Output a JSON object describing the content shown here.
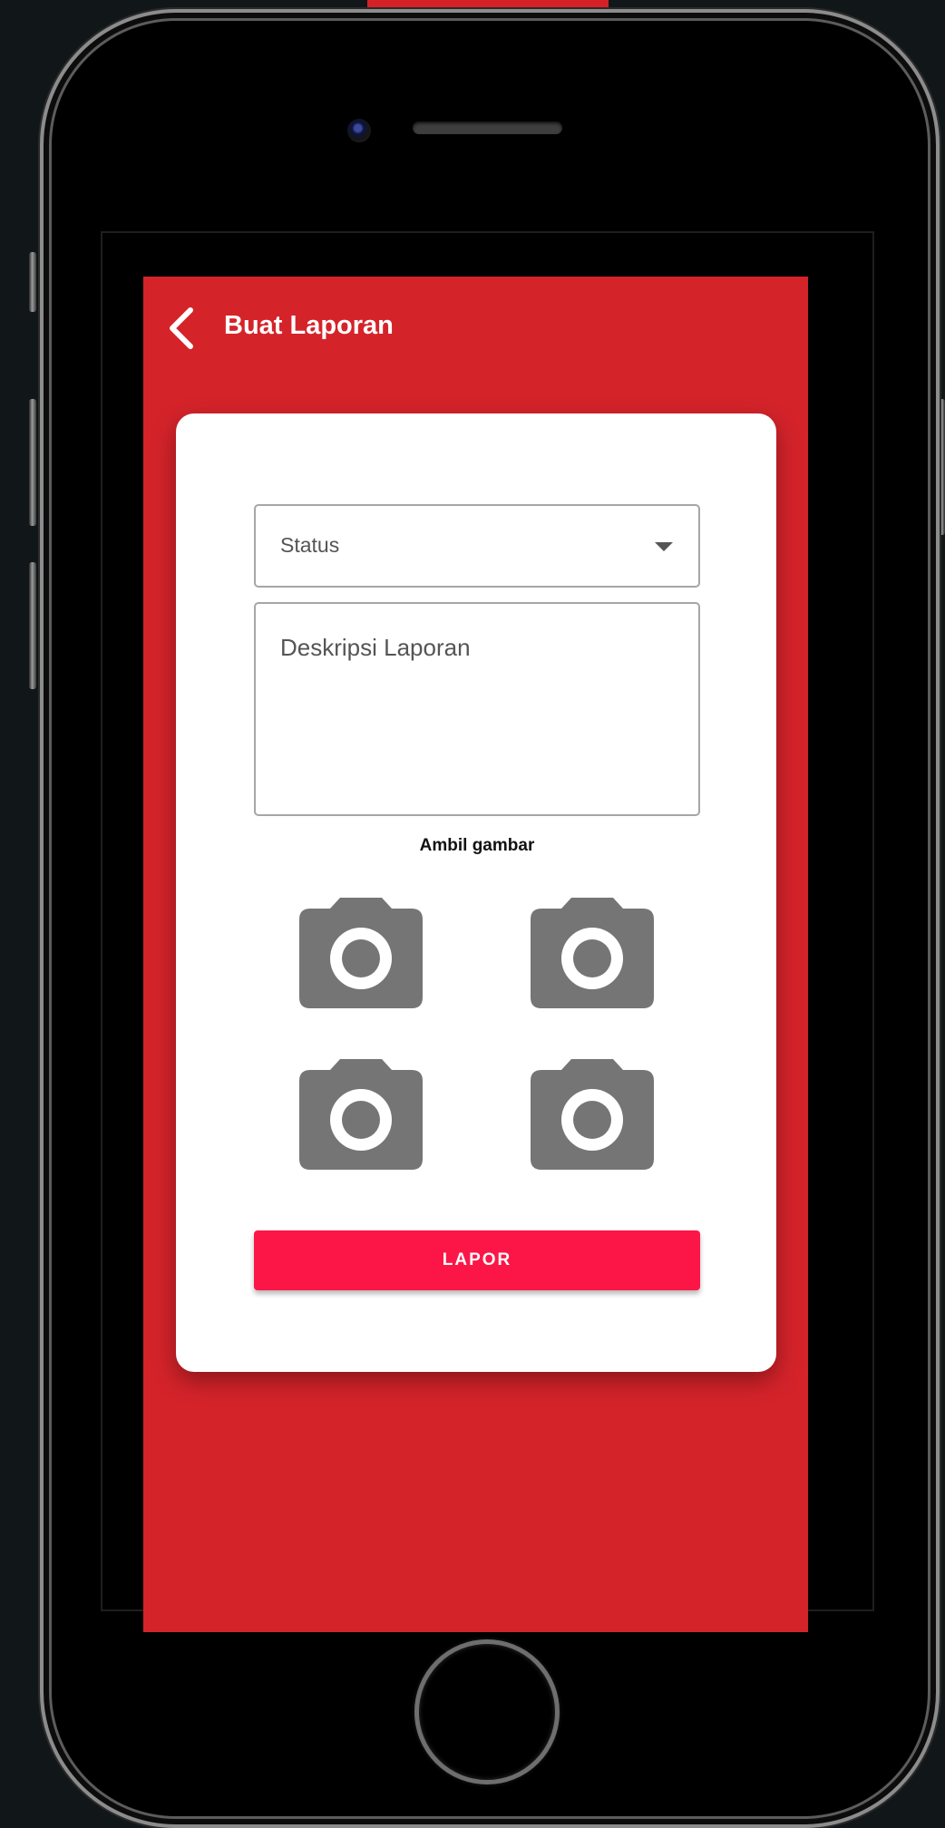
{
  "header": {
    "title": "Buat Laporan",
    "back_icon": "chevron-left-icon"
  },
  "form": {
    "status": {
      "label": "Status",
      "icon": "dropdown-arrow-icon"
    },
    "description": {
      "placeholder": "Deskripsi Laporan"
    },
    "capture_label": "Ambil gambar",
    "photo_slots": [
      {
        "icon": "camera-icon"
      },
      {
        "icon": "camera-icon"
      },
      {
        "icon": "camera-icon"
      },
      {
        "icon": "camera-icon"
      }
    ],
    "submit_label": "LAPOR"
  },
  "colors": {
    "app_background": "#d5232a",
    "submit_button": "#fc1647",
    "camera_icon": "#757575",
    "card": "#ffffff"
  }
}
